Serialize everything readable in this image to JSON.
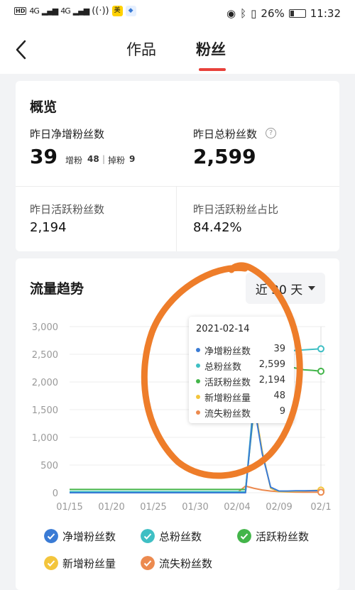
{
  "status_bar": {
    "hd1": "HD",
    "hd2": "HD",
    "net1": "4G",
    "net2": "4G",
    "badge_mei": "美",
    "battery_pct": "26%",
    "battery_level": 0.26,
    "time": "11:32"
  },
  "nav": {
    "tab_works": "作品",
    "tab_fans": "粉丝"
  },
  "overview": {
    "title": "概览",
    "net_label": "昨日净增粉丝数",
    "net_value": "39",
    "gain_label": "增粉",
    "gain_value": "48",
    "sep": "|",
    "loss_label": "掉粉",
    "loss_value": "9",
    "total_label": "昨日总粉丝数",
    "help_glyph": "?",
    "total_value": "2,599",
    "active_label": "昨日活跃粉丝数",
    "active_value": "2,194",
    "ratio_label": "昨日活跃粉丝占比",
    "ratio_value": "84.42%"
  },
  "trend": {
    "title": "流量趋势",
    "range_label": "近 30 天"
  },
  "tooltip": {
    "date": "2021-02-14",
    "rows": [
      {
        "name": "净增粉丝数",
        "value": "39",
        "color": "#3a7bd5"
      },
      {
        "name": "总粉丝数",
        "value": "2,599",
        "color": "#3fbfc4"
      },
      {
        "name": "活跃粉丝数",
        "value": "2,194",
        "color": "#43b54a"
      },
      {
        "name": "新增粉丝量",
        "value": "48",
        "color": "#f3c53c"
      },
      {
        "name": "流失粉丝数",
        "value": "9",
        "color": "#ec8a4f"
      }
    ]
  },
  "legend": [
    {
      "label": "净增粉丝数",
      "color": "#3a7bd5"
    },
    {
      "label": "总粉丝数",
      "color": "#3fbfc4"
    },
    {
      "label": "活跃粉丝数",
      "color": "#43b54a"
    },
    {
      "label": "新增粉丝量",
      "color": "#f3c53c"
    },
    {
      "label": "流失粉丝数",
      "color": "#ec8a4f"
    }
  ],
  "chart_data": {
    "type": "line",
    "x": [
      "01/15",
      "01/16",
      "01/17",
      "01/18",
      "01/19",
      "01/20",
      "01/21",
      "01/22",
      "01/23",
      "01/24",
      "01/25",
      "01/26",
      "01/27",
      "01/28",
      "01/29",
      "01/30",
      "01/31",
      "02/01",
      "02/02",
      "02/03",
      "02/04",
      "02/05",
      "02/06",
      "02/07",
      "02/08",
      "02/09",
      "02/10",
      "02/11",
      "02/12",
      "02/13",
      "02/14"
    ],
    "x_tick_labels": [
      "01/15",
      "01/20",
      "01/25",
      "01/30",
      "02/04",
      "02/09",
      "02/1"
    ],
    "x_tick_indices": [
      0,
      5,
      10,
      15,
      20,
      25,
      30
    ],
    "y_ticks": [
      "0",
      "500",
      "1,000",
      "1,500",
      "2,000",
      "2,500",
      "3,000"
    ],
    "ylim": [
      0,
      3000
    ],
    "series": [
      {
        "name": "净增粉丝数",
        "color": "#3a7bd5",
        "values": [
          0,
          0,
          0,
          0,
          0,
          0,
          0,
          0,
          0,
          0,
          0,
          0,
          0,
          0,
          0,
          0,
          0,
          0,
          0,
          0,
          0,
          0,
          1600,
          700,
          100,
          30,
          30,
          35,
          35,
          37,
          39
        ]
      },
      {
        "name": "总粉丝数",
        "color": "#3fbfc4",
        "values": [
          20,
          20,
          20,
          20,
          20,
          20,
          20,
          20,
          20,
          20,
          20,
          20,
          20,
          20,
          20,
          20,
          20,
          20,
          20,
          20,
          20,
          20,
          1700,
          2450,
          2520,
          2550,
          2560,
          2570,
          2580,
          2590,
          2599
        ]
      },
      {
        "name": "活跃粉丝数",
        "color": "#43b54a",
        "values": [
          60,
          60,
          60,
          60,
          60,
          60,
          60,
          60,
          60,
          60,
          60,
          60,
          60,
          60,
          60,
          60,
          60,
          60,
          60,
          60,
          60,
          60,
          1500,
          2100,
          2250,
          2300,
          2280,
          2250,
          2220,
          2210,
          2194
        ]
      },
      {
        "name": "新增粉丝量",
        "color": "#f3c53c",
        "values": [
          0,
          0,
          0,
          0,
          0,
          0,
          0,
          0,
          0,
          0,
          0,
          0,
          0,
          0,
          0,
          0,
          0,
          0,
          0,
          0,
          0,
          0,
          1650,
          750,
          80,
          20,
          20,
          25,
          30,
          40,
          48
        ]
      },
      {
        "name": "流失粉丝数",
        "color": "#ec8a4f",
        "values": [
          0,
          0,
          0,
          0,
          0,
          0,
          0,
          0,
          0,
          0,
          0,
          0,
          0,
          0,
          0,
          0,
          0,
          0,
          0,
          0,
          0,
          120,
          80,
          50,
          30,
          20,
          15,
          12,
          10,
          9,
          9
        ]
      }
    ]
  }
}
